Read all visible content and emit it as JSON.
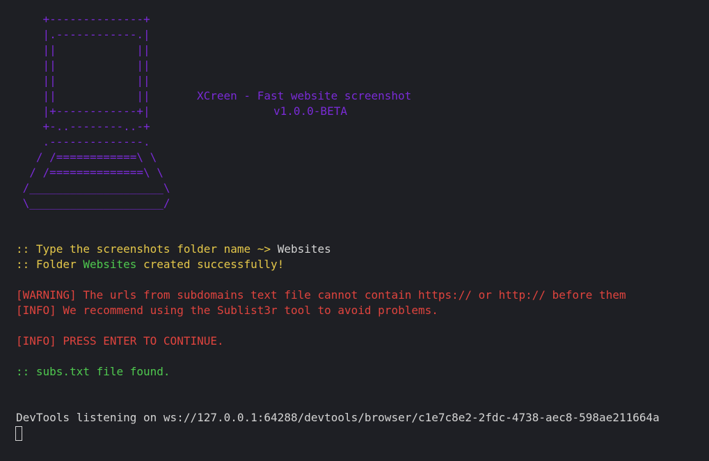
{
  "banner": {
    "art": "    +--------------+\n    |.------------.|\n    ||            ||\n    ||            ||\n    ||            ||\n    ||            ||\n    |+------------+|\n    +-..--------..-+\n    .--------------.\n   / /============\\ \\\n  / /==============\\ \\\n /____________________\\\n \\____________________/",
    "title": "XCreen - Fast website screenshot",
    "version": "v1.0.0-BETA"
  },
  "prompt": {
    "prefix": ":: Type the screenshots folder name ~> ",
    "value": "Websites"
  },
  "created": {
    "prefix": ":: Folder ",
    "folder": "Websites",
    "suffix": " created successfully!"
  },
  "warning": "[WARNING] The urls from subdomains text file cannot contain https:// or http:// before them",
  "info_recommend": "[INFO] We recommend using the Sublist3r tool to avoid problems.",
  "info_press": "[INFO] PRESS ENTER TO CONTINUE.",
  "found": ":: subs.txt file found.",
  "devtools": "DevTools listening on ws://127.0.0.1:64288/devtools/browser/c1e7c8e2-2fdc-4738-aec8-598ae211664a",
  "colors": {
    "background": "#1e1f24",
    "banner": "#7a2bd6",
    "prompt": "#e5c84a",
    "success": "#4fc94f",
    "error": "#e0443e",
    "text": "#d4d4d4"
  }
}
